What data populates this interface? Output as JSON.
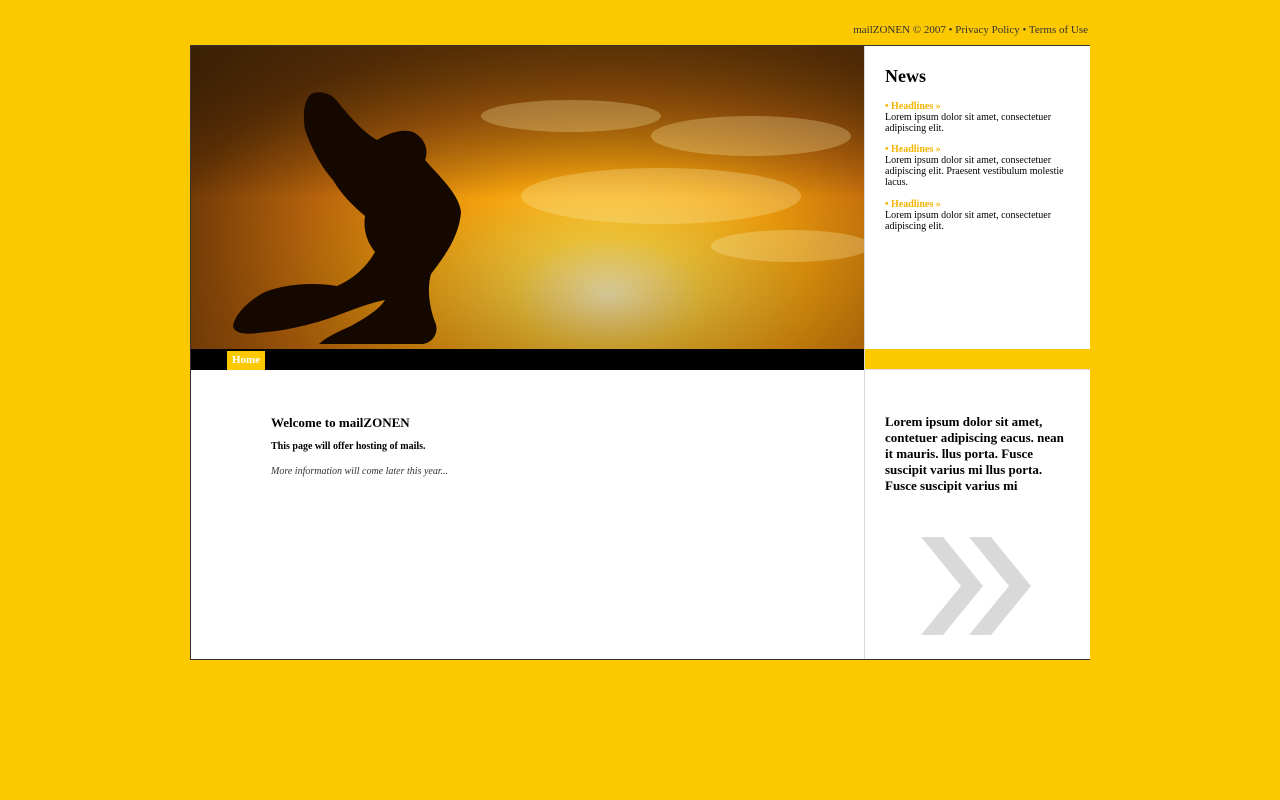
{
  "topbar": {
    "copyright": "mailZONEN © 2007",
    "separator": " • ",
    "privacy_label": "Privacy Policy",
    "terms_label": "Terms of Use"
  },
  "nav": {
    "home_label": "Home"
  },
  "news": {
    "title": "News",
    "items": [
      {
        "headline": "• Headlines »",
        "text": "Lorem ipsum dolor sit amet, consectetuer adipiscing elit."
      },
      {
        "headline": "• Headlines »",
        "text": "Lorem ipsum dolor sit amet, consectetuer adipiscing elit. Praesent vestibulum molestie lacus."
      },
      {
        "headline": "• Headlines »",
        "text": "Lorem ipsum dolor sit amet, consectetuer adipiscing elit."
      }
    ]
  },
  "main": {
    "welcome": "Welcome to mailZONEN",
    "subline": "This page will offer hosting of mails.",
    "more": "More information will come later this year..."
  },
  "side": {
    "text": "Lorem ipsum dolor sit amet, contetuer adipiscing eacus. nean it mauris. llus porta. Fusce suscipit varius mi llus porta. Fusce suscipit varius mi"
  },
  "colors": {
    "background": "#fcc800",
    "headline": "#f3b400",
    "navbar": "#000000",
    "arrow": "#d9d9d9"
  },
  "icons": {
    "hero": "jumping-silhouette-sunset-image",
    "side": "double-chevron-right-icon"
  }
}
